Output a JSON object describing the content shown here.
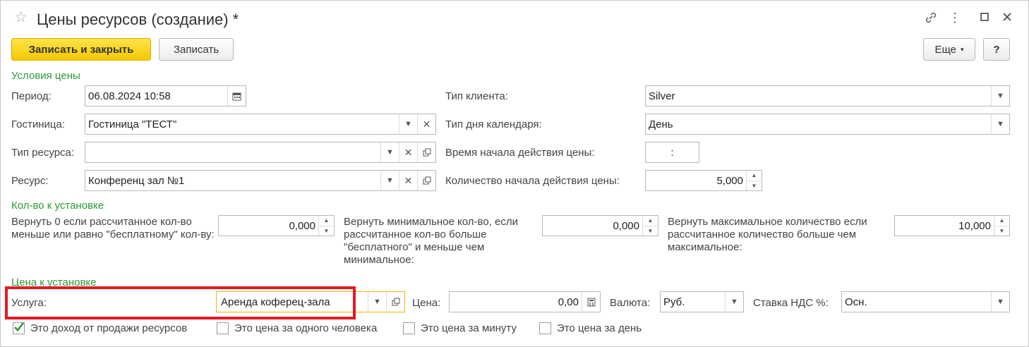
{
  "window": {
    "title": "Цены ресурсов (создание) *",
    "icons": [
      "star-icon",
      "link-icon",
      "more-icon",
      "maximize-icon",
      "close-icon"
    ]
  },
  "toolbar": {
    "save_close_label": "Записать и закрыть",
    "save_label": "Записать",
    "more_label": "Еще",
    "help_label": "?"
  },
  "sections": {
    "price_conditions": "Условия цены",
    "quantity_to_set": "Кол-во к установке",
    "price_to_set": "Цена к установке"
  },
  "fields": {
    "period": {
      "label": "Период:",
      "value": "06.08.2024 10:58"
    },
    "hotel": {
      "label": "Гостиница:",
      "value": "Гостиница \"ТЕСТ\""
    },
    "resource_type": {
      "label": "Тип ресурса:",
      "value": ""
    },
    "resource": {
      "label": "Ресурс:",
      "value": "Конференц зал №1"
    },
    "client_type": {
      "label": "Тип клиента:",
      "value": "Silver"
    },
    "calendar_day_type": {
      "label": "Тип дня календаря:",
      "value": "День"
    },
    "price_start_time": {
      "label": "Время начала действия цены:",
      "value": ":"
    },
    "price_start_quantity": {
      "label": "Количество начала действия цены:",
      "value": "5,000"
    },
    "return_zero": {
      "label": "Вернуть 0 если рассчитанное кол-во меньше или равно \"бесплатному\" кол-ву:",
      "value": "0,000"
    },
    "return_min": {
      "label": "Вернуть минимальное кол-во, если рассчитанное кол-во больше \"бесплатного\" и меньше чем минимальное:",
      "value": "0,000"
    },
    "return_max": {
      "label": "Вернуть максимальное количество если рассчитанное количество больше чем максимальное:",
      "value": "10,000"
    },
    "service": {
      "label": "Услуга:",
      "value": "Аренда кофе­рец-зала"
    },
    "price": {
      "label": "Цена:",
      "value": "0,00"
    },
    "currency": {
      "label": "Валюта:",
      "value": "Руб."
    },
    "vat_rate": {
      "label": "Ставка НДС %:",
      "value": "Осн."
    }
  },
  "checkboxes": [
    {
      "label": "Это доход от продажи ресурсов",
      "checked": true
    },
    {
      "label": "Это цена за одного человека",
      "checked": false
    },
    {
      "label": "Это цена за минуту",
      "checked": false
    },
    {
      "label": "Это цена за день",
      "checked": false
    }
  ],
  "colors": {
    "section_green": "#2c9a3a",
    "primary_button": "#f5c800",
    "highlight_red": "#e01b24",
    "focus_orange": "#f0b400"
  }
}
